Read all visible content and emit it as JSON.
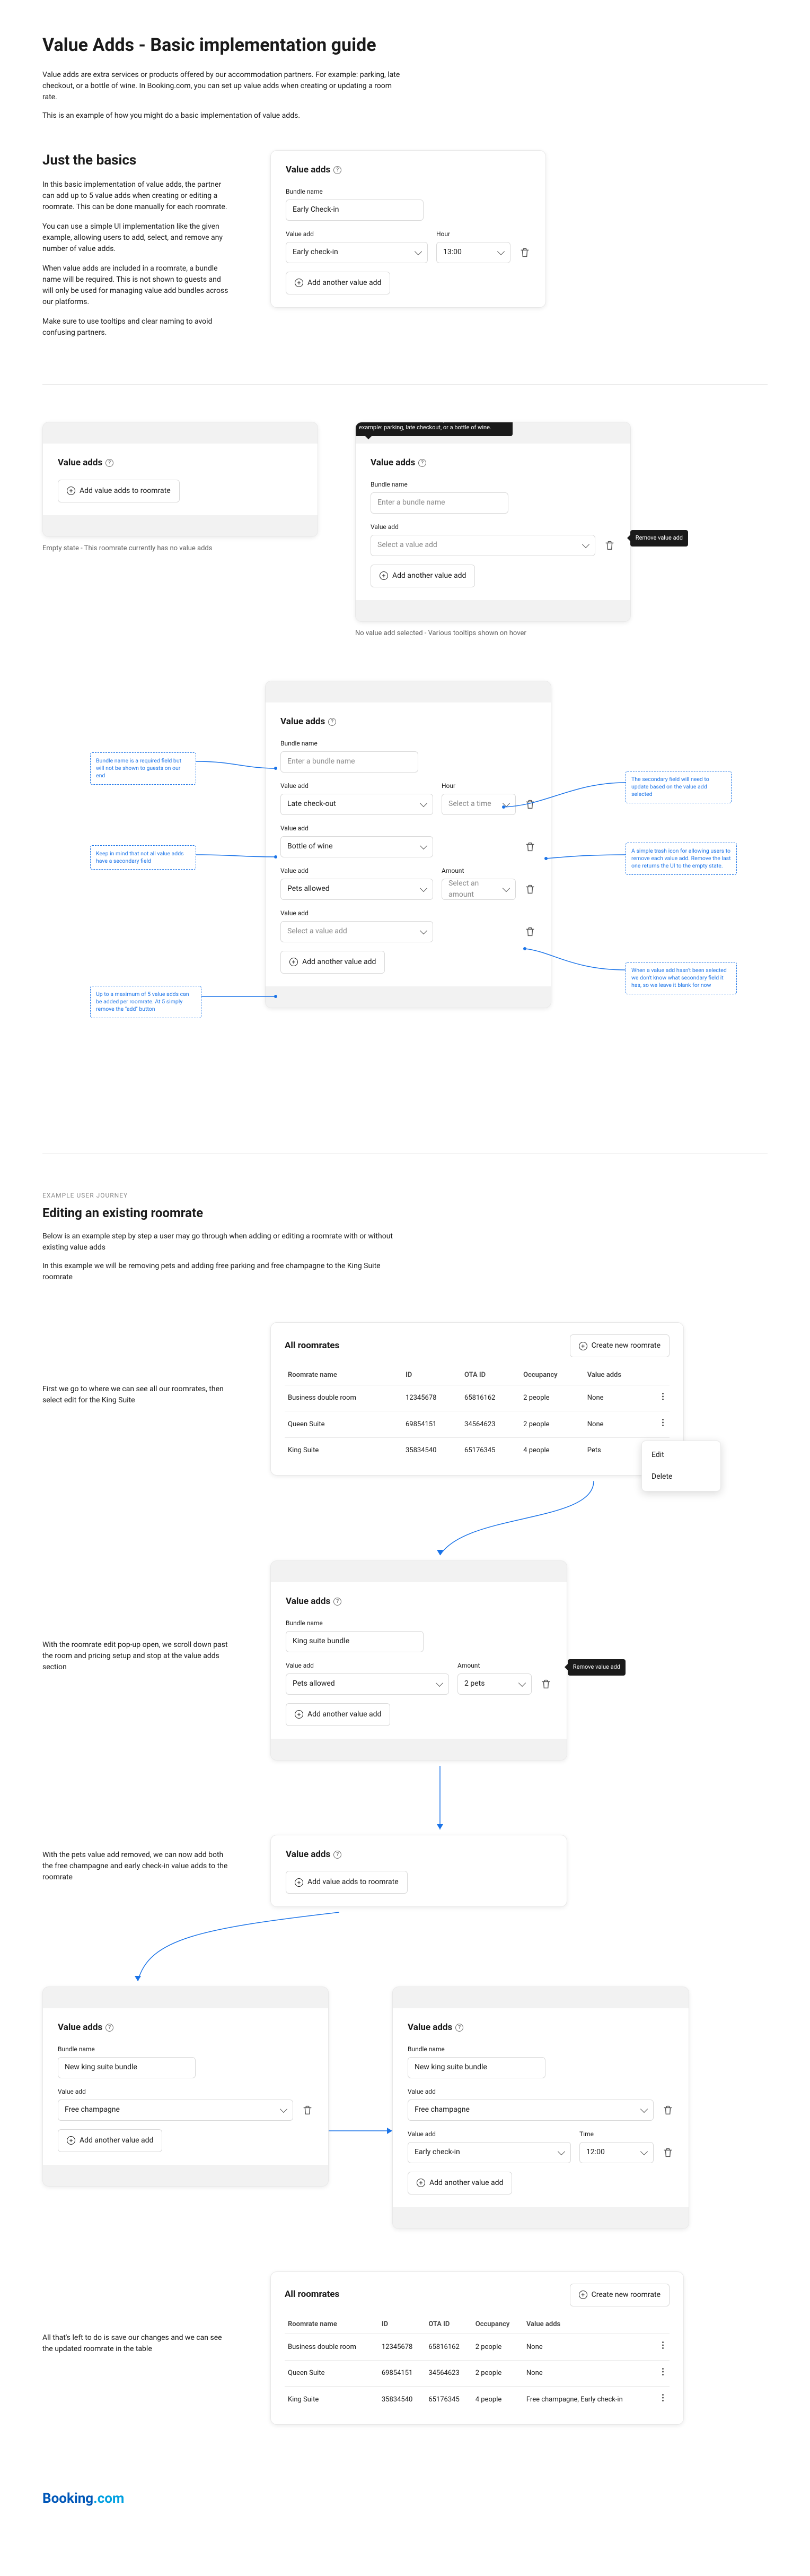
{
  "page": {
    "title": "Value Adds - Basic implementation guide",
    "intro1": "Value adds are extra services or products offered by our accommodation partners. For example: parking, late checkout, or a bottle of wine. In Booking.com, you can set up value adds when creating or updating a room rate.",
    "intro2": "This is an example of how you might do a basic implementation of value adds."
  },
  "basics": {
    "heading": "Just the basics",
    "p1": "In this basic implementation of value adds, the partner can add up to 5 value adds when creating or editing a roomrate. This can be done manually for each roomrate.",
    "p2": "You can use a simple UI implementation like the given example, allowing users to add, select, and remove any number of value adds.",
    "p3": "When value adds are included in a roomrate, a bundle name will be required. This is not shown to guests and will only be used for managing value add bundles across our platforms.",
    "p4": "Make sure to use tooltips and clear naming to avoid confusing partners."
  },
  "card_labels": {
    "title": "Value adds",
    "bundle_name": "Bundle name",
    "value_add": "Value add",
    "hour": "Hour",
    "time": "Time",
    "amount": "Amount",
    "add_another": "Add another value add",
    "add_to_roomrate": "Add value adds to roomrate",
    "select_value_add": "Select a value add",
    "select_time": "Select a time",
    "select_amount": "Select an amount",
    "enter_bundle": "Enter a bundle name"
  },
  "example1": {
    "bundle_value": "Early Check-in",
    "value_add_selected": "Early check-in",
    "hour_selected": "13:00"
  },
  "empty_caption": "Empty state - This roomrate currently has no value adds",
  "tooltip_help": "Value adds are extra services or products offered. For example: parking, late checkout, or a bottle of wine.",
  "tooltip_trash": "Remove value add",
  "tooltips_caption": "No value add selected - Various tooltips shown on hover",
  "annotated": {
    "note_bundle": "Bundle name is a required field but will not be shown to guests on our end",
    "note_secondary": "The secondary field will need to update based on the value add selected",
    "note_not_all": "Keep in mind that not all value adds have a secondary field",
    "note_trash": "A simple trash icon for allowing users to remove each value add. Remove the last one returns the UI to the empty state.",
    "note_blank": "When a value add hasn't been selected we don't know what secondary field it has, so we leave it blank for now",
    "note_max": "Up to a maximum of 5 value adds can be added per roomrate. At 5 simply remove the \"add\" button",
    "rows": {
      "r1": {
        "value": "Late check-out"
      },
      "r2": {
        "value": "Bottle of wine"
      },
      "r3": {
        "value": "Pets allowed"
      },
      "r4": {
        "value": "Select a value add"
      }
    }
  },
  "journey": {
    "eyebrow": "EXAMPLE USER JOURNEY",
    "heading": "Editing an existing roomrate",
    "p1": "Below is an example step by step a user may go through when adding or editing a roomrate with or without existing value adds",
    "p2": "In this example we will be removing pets and adding free parking and free champagne to the King Suite roomrate",
    "step1": "First we go to where we can see all our roomrates, then select edit for the King Suite",
    "step2": "With the roomrate edit pop-up open, we scroll down past the room and pricing setup and stop at the value adds section",
    "step3": "With the pets value add removed, we can now add both the free champagne and early check-in value adds to the roomrate",
    "step4": "All that's left to do is save our changes and we can see the updated roomrate in the table"
  },
  "table": {
    "title": "All roomrates",
    "create": "Create new roomrate",
    "cols": [
      "Roomrate name",
      "ID",
      "OTA ID",
      "Occupancy",
      "Value adds"
    ],
    "rows1": [
      {
        "name": "Business double room",
        "id": "12345678",
        "ota": "65816162",
        "occ": "2 people",
        "va": "None"
      },
      {
        "name": "Queen Suite",
        "id": "69854151",
        "ota": "34564623",
        "occ": "2 people",
        "va": "None"
      },
      {
        "name": "King Suite",
        "id": "35834540",
        "ota": "65176345",
        "occ": "4 people",
        "va": "Pets"
      }
    ],
    "rows2": [
      {
        "name": "Business double room",
        "id": "12345678",
        "ota": "65816162",
        "occ": "2 people",
        "va": "None"
      },
      {
        "name": "Queen Suite",
        "id": "69854151",
        "ota": "34564623",
        "occ": "2 people",
        "va": "None"
      },
      {
        "name": "King Suite",
        "id": "35834540",
        "ota": "65176345",
        "occ": "4 people",
        "va": "Free champagne, Early check-in"
      }
    ],
    "menu": {
      "edit": "Edit",
      "delete": "Delete"
    }
  },
  "journey_cards": {
    "pets": {
      "bundle": "King suite bundle",
      "value": "Pets allowed",
      "amount_label": "Amount",
      "amount": "2 pets"
    },
    "champ": {
      "bundle": "New king suite bundle",
      "value": "Free champagne"
    },
    "full": {
      "bundle": "New king suite bundle",
      "r1": {
        "value": "Free champagne"
      },
      "r2": {
        "value": "Early check-in",
        "time": "12:00"
      }
    }
  },
  "brand": {
    "name": "Booking",
    "suffix": ".com"
  }
}
